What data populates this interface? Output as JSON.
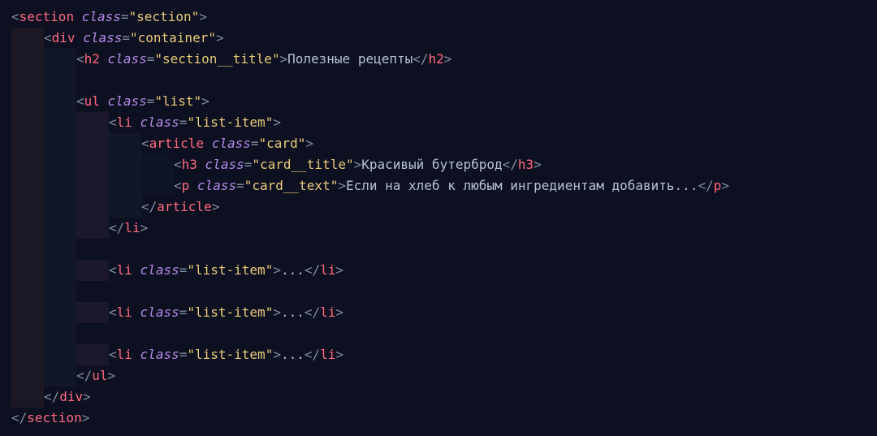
{
  "tags": {
    "section": "section",
    "div": "div",
    "h2": "h2",
    "ul": "ul",
    "li": "li",
    "article": "article",
    "h3": "h3",
    "p": "p"
  },
  "attr": {
    "class": "class"
  },
  "classes": {
    "section": "\"section\"",
    "container": "\"container\"",
    "section_title": "\"section__title\"",
    "list": "\"list\"",
    "list_item": "\"list-item\"",
    "card": "\"card\"",
    "card_title": "\"card__title\"",
    "card_text": "\"card__text\""
  },
  "content": {
    "h2": "Полезные рецепты",
    "h3": "Красивый бутерброд",
    "p": "Если на хлеб к любым ингредиентам добавить...",
    "ellipsis": "..."
  },
  "punct": {
    "lt": "<",
    "gt": ">",
    "lts": "</",
    "eq": "=",
    "sp": " "
  }
}
